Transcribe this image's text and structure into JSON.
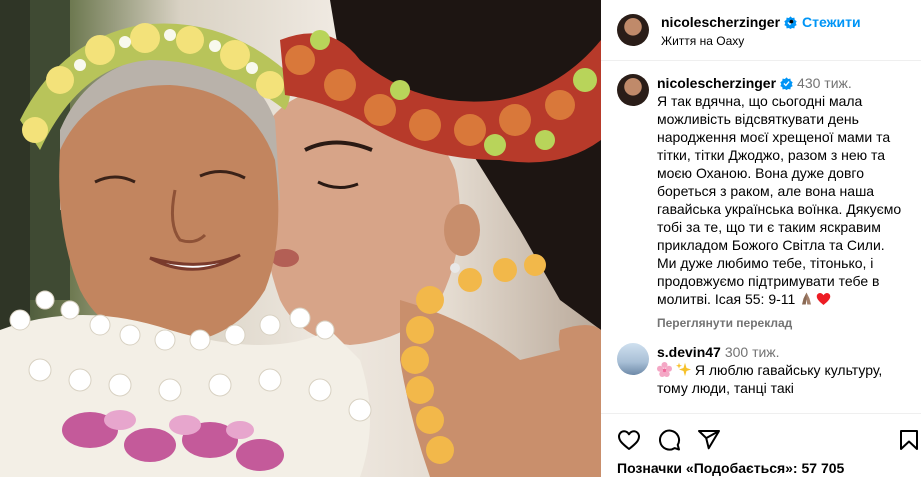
{
  "post": {
    "username": "nicolescherzinger",
    "follow_separator": "•",
    "follow_label": "Стежити",
    "location": "Життя на Оаху"
  },
  "caption": {
    "username": "nicolescherzinger",
    "age": "430 тиж.",
    "text": "Я так вдячна, що сьогодні мала можливість відсвяткувати день народження моєї хрещеної мами та тітки, тітки Джоджо, разом з нею та моєю Оханою. Вона дуже довго бореться з раком, але вона наша гавайська українська воїнка. Дякуємо тобі за те, що ти є таким яскравим прикладом Божого Світла та Сили. Ми дуже любимо тебе, тітонько, і продовжуємо підтримувати тебе в молитві. Ісая 55: 9-11",
    "translate_label": "Переглянути переклад",
    "emojis": [
      "pray-icon",
      "heart-icon"
    ]
  },
  "comment": {
    "username": "s.devin47",
    "age": "300 тиж.",
    "text": "Я люблю гавайську культуру, тому люди, танці такі",
    "emojis": [
      "cherry-blossom-icon",
      "sparkles-icon"
    ]
  },
  "actions": {
    "icons": [
      "heart-outline-icon",
      "comment-icon",
      "share-icon",
      "bookmark-icon"
    ],
    "likes_text": "Позначки «Подобається»: 57 705"
  },
  "colors": {
    "accent": "#0095f6",
    "verified": "#0095f6",
    "secondary_text": "#737373",
    "heart": "#ed1c24"
  }
}
